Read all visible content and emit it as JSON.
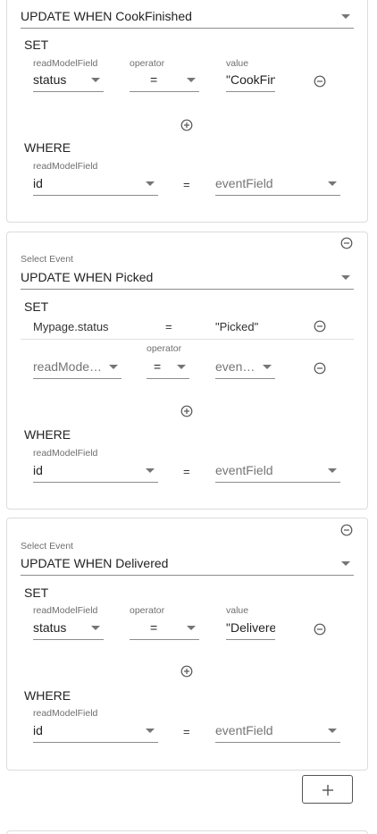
{
  "labels": {
    "select_event": "Select Event",
    "set": "SET",
    "where": "WHERE",
    "read_model_field": "readModelField",
    "operator": "operator",
    "value": "value",
    "equals": "="
  },
  "cards": [
    {
      "event": "UPDATE WHEN CookFinished",
      "set_row": {
        "field": "status",
        "operator": "=",
        "value": "\"CookFinished\""
      },
      "where": {
        "field": "id",
        "event_field": "eventField"
      }
    },
    {
      "event": "UPDATE WHEN Picked",
      "set_static": {
        "field": "Mypage.status",
        "operator": "=",
        "value": "\"Picked\""
      },
      "set_row": {
        "field": "readModelField",
        "operator": "=",
        "value": "eventField"
      },
      "where": {
        "field": "id",
        "event_field": "eventField"
      }
    },
    {
      "event": "UPDATE WHEN Delivered",
      "set_row": {
        "field": "status",
        "operator": "=",
        "value": "\"Delivered\""
      },
      "where": {
        "field": "id",
        "event_field": "eventField"
      }
    }
  ],
  "add_button": "+"
}
